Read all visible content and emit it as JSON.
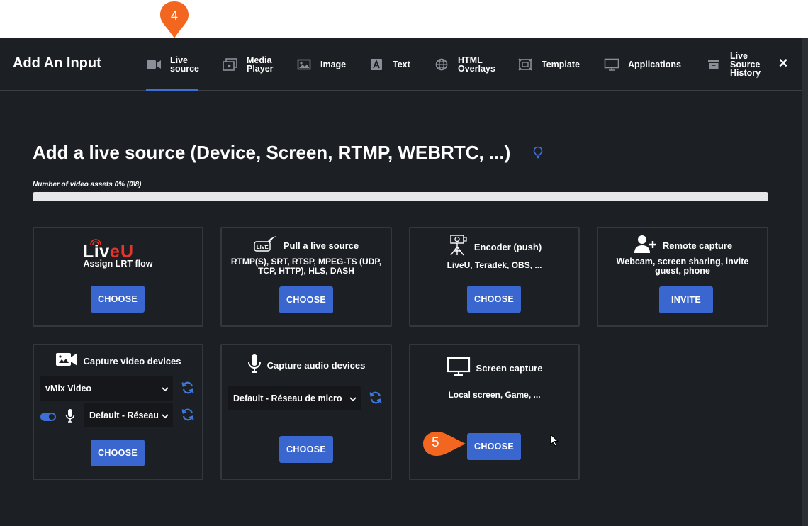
{
  "modal": {
    "title": "Add An Input",
    "tabs": [
      {
        "line1": "Live",
        "line2": "source",
        "icon": "camera-icon",
        "active": true
      },
      {
        "line1": "Media",
        "line2": "Player",
        "icon": "media-player-icon"
      },
      {
        "line1": "Image",
        "line2": "",
        "icon": "image-icon"
      },
      {
        "line1": "Text",
        "line2": "",
        "icon": "text-icon"
      },
      {
        "line1": "HTML",
        "line2": "Overlays",
        "icon": "globe-icon"
      },
      {
        "line1": "Template",
        "line2": "",
        "icon": "template-icon"
      },
      {
        "line1": "Applications",
        "line2": "",
        "icon": "monitor-icon"
      },
      {
        "line1": "Live",
        "line2": "Source",
        "line3": "History",
        "icon": "archive-icon"
      }
    ],
    "close_label": "×"
  },
  "main": {
    "title": "Add a live source (Device, Screen, RTMP, WEBRTC, ...)",
    "asset_label": "Number of video assets 0% (0\\8)",
    "asset_progress": 0
  },
  "cards": {
    "liveu": {
      "logo": "LiveU",
      "desc": "Assign LRT flow",
      "button": "CHOOSE"
    },
    "pull": {
      "title": "Pull a live source",
      "desc": "RTMP(S), SRT, RTSP, MPEG-TS (UDP, TCP, HTTP), HLS, DASH",
      "button": "CHOOSE",
      "icon_text": "LIVE"
    },
    "encoder": {
      "title": "Encoder (push)",
      "desc": "LiveU, Teradek, OBS, ...",
      "button": "CHOOSE"
    },
    "remote": {
      "title": "Remote capture",
      "desc": "Webcam, screen sharing, invite guest, phone",
      "button": "INVITE"
    },
    "video_devices": {
      "title": "Capture video devices",
      "video_select": "vMix Video",
      "audio_select": "Default - Réseau",
      "toggle_on": true,
      "button": "CHOOSE"
    },
    "audio_devices": {
      "title": "Capture audio devices",
      "audio_select": "Default - Réseau de micro",
      "button": "CHOOSE"
    },
    "screen": {
      "title": "Screen capture",
      "desc": "Local screen, Game, ...",
      "button": "CHOOSE"
    }
  },
  "annotations": {
    "step4": "4",
    "step5": "5",
    "color": "#f2661f"
  },
  "colors": {
    "background": "#1c1f24",
    "accent": "#3a67cf",
    "liveu_red": "#e8352b"
  }
}
